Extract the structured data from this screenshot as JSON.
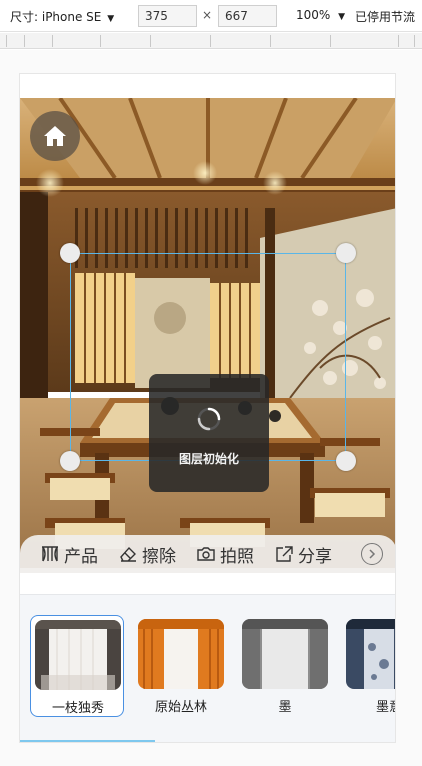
{
  "devtools": {
    "device_label": "尺寸: iPhone SE",
    "width_value": "375",
    "height_value": "667",
    "dim_separator": "×",
    "zoom_label": "100%",
    "throttle_label": "已停用节流",
    "caret": "▼"
  },
  "toolbar": {
    "items": [
      {
        "label": "产品",
        "icon": "product-icon"
      },
      {
        "label": "擦除",
        "icon": "eraser-icon"
      },
      {
        "label": "拍照",
        "icon": "camera-icon"
      },
      {
        "label": "分享",
        "icon": "share-icon"
      }
    ],
    "more_icon": "chevron-right-icon"
  },
  "loading": {
    "label": "图层初始化"
  },
  "products": [
    {
      "name": "一枝独秀",
      "selected": true,
      "palette": [
        "#c9c2bb",
        "#f3f1ee",
        "#4a4440"
      ]
    },
    {
      "name": "原始丛林",
      "selected": false,
      "palette": [
        "#e07a1f",
        "#f6f3ef",
        "#b85a10"
      ]
    },
    {
      "name": "墨",
      "selected": false,
      "palette": [
        "#8d8d8d",
        "#e9e9e9",
        "#555555"
      ]
    },
    {
      "name": "墨意",
      "selected": false,
      "palette": [
        "#3a4a63",
        "#d7dde6",
        "#1f2a3a"
      ]
    }
  ],
  "colors": {
    "selection": "#5ab6e8",
    "thumb_selected_border": "#4a90e2",
    "scroll_indicator": "#7ec8ee"
  }
}
